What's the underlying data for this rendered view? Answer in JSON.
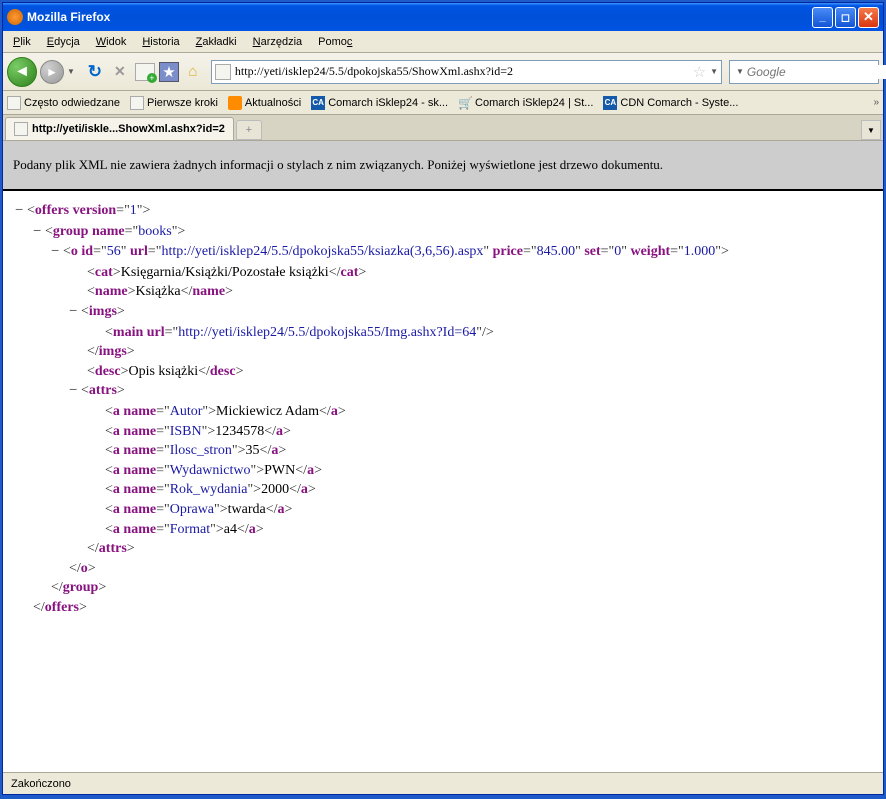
{
  "window_title": "Mozilla Firefox",
  "menu": {
    "file": "Plik",
    "edit": "Edycja",
    "view": "Widok",
    "history": "Historia",
    "bookmarks": "Zakładki",
    "tools": "Narzędzia",
    "help": "Pomoc"
  },
  "url": "http://yeti/isklep24/5.5/dpokojska55/ShowXml.ashx?id=2",
  "search_placeholder": "Google",
  "bookmarks": {
    "b1": "Często odwiedzane",
    "b2": "Pierwsze kroki",
    "b3": "Aktualności",
    "b4": "Comarch iSklep24 - sk...",
    "b5": "Comarch iSklep24 | St...",
    "b6": "CDN Comarch - Syste..."
  },
  "tab_title": "http://yeti/iskle...ShowXml.ashx?id=2",
  "info_message": "Podany plik XML nie zawiera żadnych informacji o stylach z nim związanych. Poniżej wyświetlone jest drzewo dokumentu.",
  "xml": {
    "root_tag": "offers",
    "root_attr_version": "version",
    "root_attr_version_val": "1",
    "group_tag": "group",
    "group_attr_name": "name",
    "group_attr_name_val": "books",
    "o_tag": "o",
    "o_id": "id",
    "o_id_val": "56",
    "o_url": "url",
    "o_url_val": "http://yeti/isklep24/5.5/dpokojska55/ksiazka(3,6,56).aspx",
    "o_price": "price",
    "o_price_val": "845.00",
    "o_set": "set",
    "o_set_val": "0",
    "o_weight": "weight",
    "o_weight_val": "1.000",
    "cat_tag": "cat",
    "cat_val": "Księgarnia/Książki/Pozostałe książki",
    "name_tag": "name",
    "name_val": "Książka",
    "imgs_tag": "imgs",
    "main_tag": "main",
    "main_url": "url",
    "main_url_val": "http://yeti/isklep24/5.5/dpokojska55/Img.ashx?Id=64",
    "desc_tag": "desc",
    "desc_val": "Opis książki",
    "attrs_tag": "attrs",
    "a_tag": "a",
    "a_name_attr": "name",
    "a1_name": "Autor",
    "a1_val": "Mickiewicz Adam",
    "a2_name": "ISBN",
    "a2_val": "1234578",
    "a3_name": "Ilosc_stron",
    "a3_val": "35",
    "a4_name": "Wydawnictwo",
    "a4_val": "PWN",
    "a5_name": "Rok_wydania",
    "a5_val": "2000",
    "a6_name": "Oprawa",
    "a6_val": "twarda",
    "a7_name": "Format",
    "a7_val": "a4"
  },
  "status": "Zakończono"
}
